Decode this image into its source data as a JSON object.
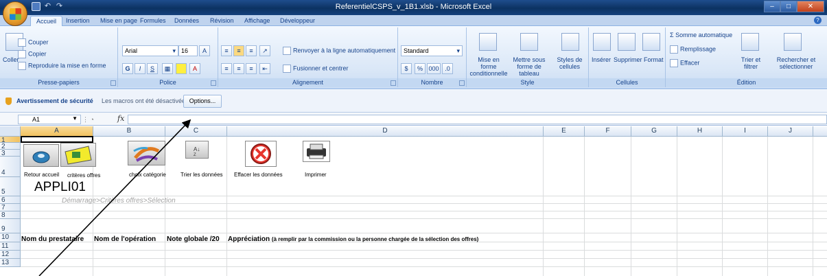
{
  "window": {
    "title": "ReferentielCSPS_v_1B1.xlsb - Microsoft Excel",
    "min": "–",
    "max": "□",
    "close": "✕"
  },
  "tabs": [
    "Accueil",
    "Insertion",
    "Mise en page",
    "Formules",
    "Données",
    "Révision",
    "Affichage",
    "Développeur"
  ],
  "ribbon": {
    "clipboard": {
      "label": "Presse-papiers",
      "paste": "Coller",
      "cut": "Couper",
      "copy": "Copier",
      "format_painter": "Reproduire la mise en forme"
    },
    "font": {
      "label": "Police",
      "name": "Arial",
      "size": "16",
      "bold": "G",
      "italic": "I",
      "underline": "S"
    },
    "alignment": {
      "label": "Alignement",
      "wrap": "Renvoyer à la ligne automatiquement",
      "merge": "Fusionner et centrer"
    },
    "number": {
      "label": "Nombre",
      "format": "Standard",
      "percent": "%",
      "thousands": "000"
    },
    "style": {
      "label": "Style",
      "conditional": "Mise en forme conditionnelle",
      "as_table": "Mettre sous forme de tableau",
      "cell_styles": "Styles de cellules"
    },
    "cells": {
      "label": "Cellules",
      "insert": "Insérer",
      "delete": "Supprimer",
      "format": "Format"
    },
    "editing": {
      "label": "Édition",
      "autosum": "Somme automatique",
      "fill": "Remplissage",
      "clear": "Effacer",
      "sort": "Trier et filtrer",
      "find": "Rechercher et sélectionner"
    }
  },
  "security": {
    "title": "Avertissement de sécurité",
    "message": "Les macros ont été désactivées.",
    "options": "Options..."
  },
  "formula_bar": {
    "cell_ref": "A1",
    "fx": "fx",
    "value": ""
  },
  "columns": [
    "A",
    "B",
    "C",
    "D",
    "E",
    "F",
    "G",
    "H",
    "I",
    "J"
  ],
  "rows": [
    "1",
    "2",
    "3",
    "4",
    "5",
    "6",
    "7",
    "8",
    "9",
    "10",
    "11",
    "12",
    "13"
  ],
  "sheet": {
    "buttons": {
      "home": "Retour accueil",
      "criteria": "critères offres",
      "category": "choix catégorie",
      "sort": "Trier les données",
      "erase": "Effacer les données",
      "print": "Imprimer"
    },
    "app_title": "APPLI01",
    "breadcrumb": "Démarrage>Critères offres>Sélection",
    "headers": {
      "provider": "Nom du prestataire",
      "operation": "Nom de l'opération",
      "score": "Note globale /20",
      "appraisal": "Appréciation",
      "appraisal_note": "(à remplir par la commission ou la personne chargée de la sélection des offres)"
    }
  },
  "colors": {
    "ribbon_bg": "#dae7f7",
    "titlebar": "#0c3262",
    "selected_header": "#f1c15f"
  }
}
